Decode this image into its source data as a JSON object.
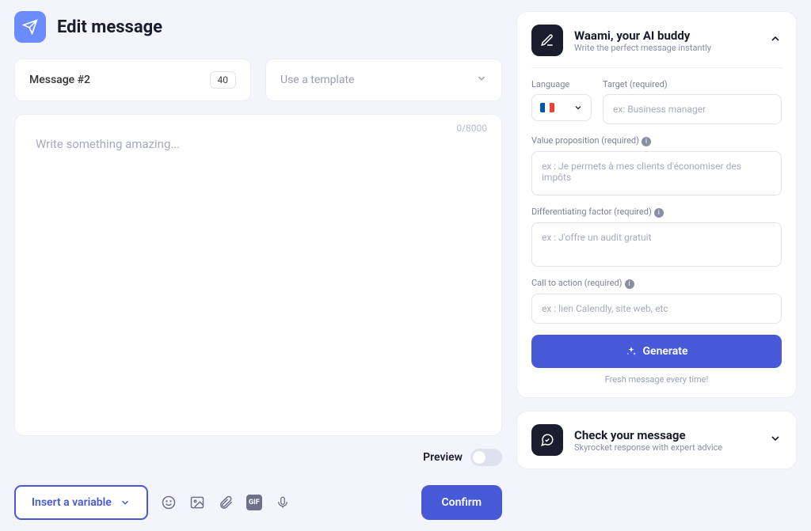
{
  "header": {
    "title": "Edit message"
  },
  "message": {
    "name": "Message #2",
    "count": "40"
  },
  "template": {
    "placeholder": "Use a template"
  },
  "editor": {
    "placeholder": "Write something amazing...",
    "counter": "0/8000"
  },
  "preview": {
    "label": "Preview"
  },
  "bottom": {
    "insert_variable": "Insert a variable",
    "confirm": "Confirm"
  },
  "waami": {
    "title": "Waami, your AI buddy",
    "subtitle": "Write the perfect message instantly",
    "language_label": "Language",
    "target_label": "Target (required)",
    "target_placeholder": "ex: Business manager",
    "value_label": "Value proposition (required)",
    "value_placeholder": "ex : Je permets à mes clients d'économiser des impôts",
    "diff_label": "Differentiating factor (required)",
    "diff_placeholder": "ex : J'offre un audit gratuit",
    "cta_label": "Call to action (required)",
    "cta_placeholder": "ex : lien Calendly, site web, etc",
    "generate": "Generate",
    "fresh": "Fresh message every time!"
  },
  "check": {
    "title": "Check your message",
    "subtitle": "Skyrocket response with expert advice"
  }
}
